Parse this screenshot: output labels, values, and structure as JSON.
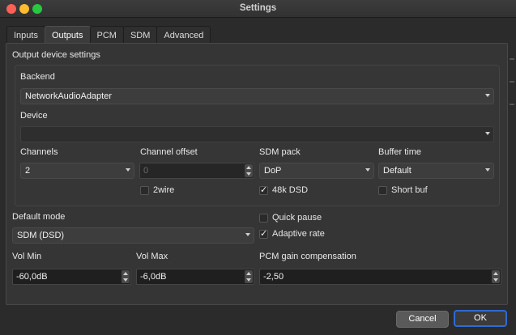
{
  "window": {
    "title": "Settings"
  },
  "tabs": [
    {
      "label": "Inputs",
      "active": false
    },
    {
      "label": "Outputs",
      "active": true
    },
    {
      "label": "PCM",
      "active": false
    },
    {
      "label": "SDM",
      "active": false
    },
    {
      "label": "Advanced",
      "active": false
    }
  ],
  "output": {
    "section_label": "Output device settings",
    "backend_label": "Backend",
    "backend_value": "NetworkAudioAdapter",
    "device_label": "Device",
    "device_value": "",
    "channels_label": "Channels",
    "channels_value": "2",
    "channel_offset_label": "Channel offset",
    "channel_offset_value": "0",
    "sdm_pack_label": "SDM pack",
    "sdm_pack_value": "DoP",
    "buffer_time_label": "Buffer time",
    "buffer_time_value": "Default",
    "twowire_label": "2wire",
    "twowire_checked": false,
    "dsd48k_label": "48k DSD",
    "dsd48k_checked": true,
    "short_buf_label": "Short buf",
    "short_buf_checked": false
  },
  "general": {
    "default_mode_label": "Default mode",
    "default_mode_value": "SDM (DSD)",
    "quick_pause_label": "Quick pause",
    "quick_pause_checked": false,
    "adaptive_rate_label": "Adaptive rate",
    "adaptive_rate_checked": true,
    "vol_min_label": "Vol Min",
    "vol_min_value": "-60,0dB",
    "vol_max_label": "Vol Max",
    "vol_max_value": "-6,0dB",
    "pcm_gain_label": "PCM gain compensation",
    "pcm_gain_value": "-2,50"
  },
  "footer": {
    "cancel_label": "Cancel",
    "ok_label": "OK"
  },
  "colors": {
    "accent": "#2e6bd3",
    "close": "#fe5f57",
    "minimize": "#febc2e",
    "zoom": "#28c840"
  }
}
